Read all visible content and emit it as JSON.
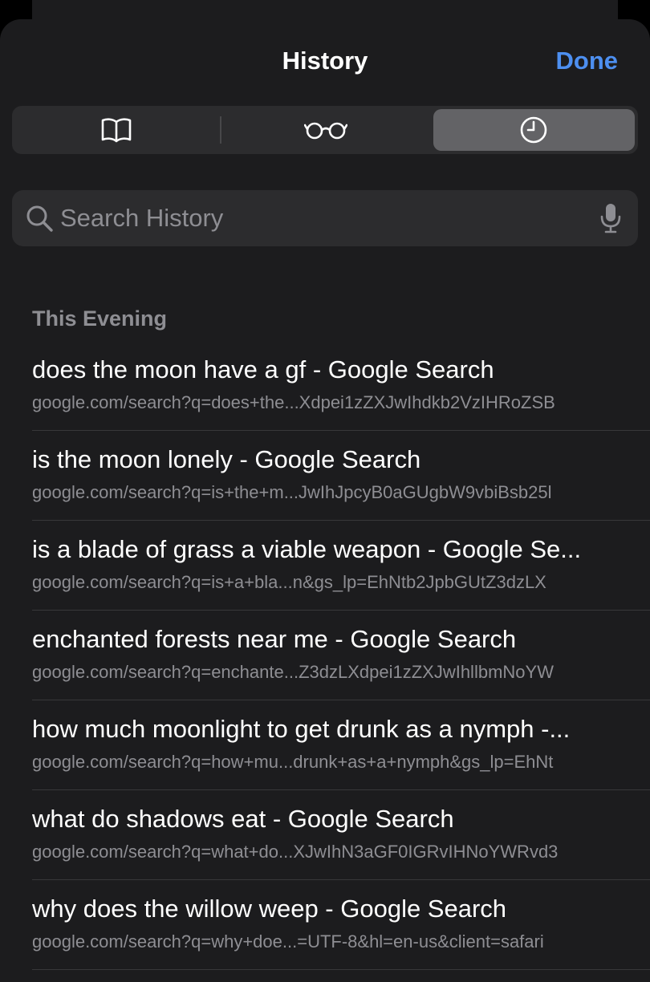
{
  "header": {
    "title": "History",
    "done_label": "Done"
  },
  "segments": [
    {
      "icon": "book-icon",
      "active": false
    },
    {
      "icon": "reading-list-icon",
      "active": false
    },
    {
      "icon": "clock-icon",
      "active": true
    }
  ],
  "search": {
    "placeholder": "Search History",
    "value": ""
  },
  "section": {
    "label": "This Evening"
  },
  "history": [
    {
      "title": "does the moon have a gf - Google Search",
      "url": "google.com/search?q=does+the...Xdpei1zZXJwIhdkb2VzIHRoZSB"
    },
    {
      "title": "is the moon lonely - Google Search",
      "url": "google.com/search?q=is+the+m...JwIhJpcyB0aGUgbW9vbiBsb25l"
    },
    {
      "title": "is a blade of grass a viable weapon - Google Se...",
      "url": "google.com/search?q=is+a+bla...n&gs_lp=EhNtb2JpbGUtZ3dzLX"
    },
    {
      "title": "enchanted forests near me - Google Search",
      "url": "google.com/search?q=enchante...Z3dzLXdpei1zZXJwIhllbmNoYW"
    },
    {
      "title": "how much moonlight to get drunk as a nymph -...",
      "url": "google.com/search?q=how+mu...drunk+as+a+nymph&gs_lp=EhNt"
    },
    {
      "title": "what do shadows eat - Google Search",
      "url": "google.com/search?q=what+do...XJwIhN3aGF0IGRvIHNoYWRvd3"
    },
    {
      "title": "why does the willow weep - Google Search",
      "url": "google.com/search?q=why+doe...=UTF-8&hl=en-us&client=safari"
    }
  ],
  "colors": {
    "accent": "#4d8ff0",
    "background": "#1c1c1e",
    "secondary_text": "#8e8e93"
  }
}
